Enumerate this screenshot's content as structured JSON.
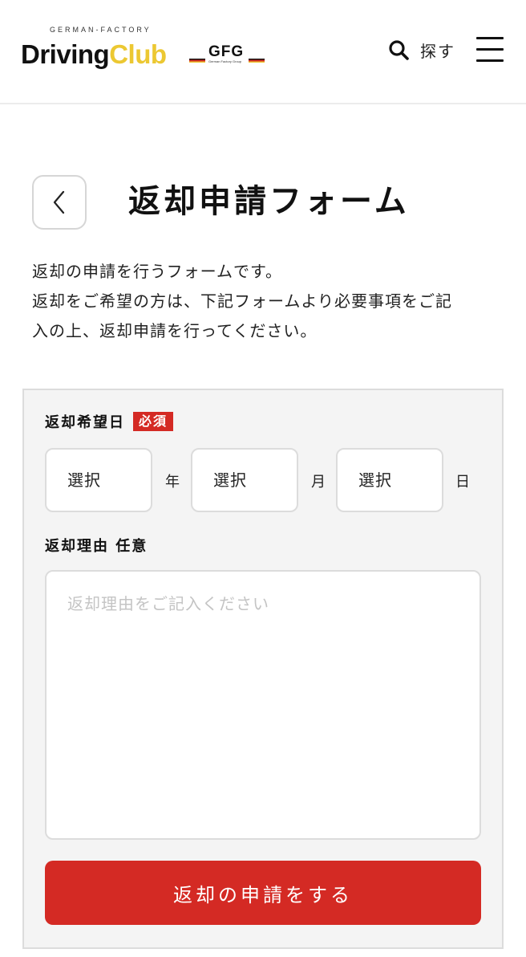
{
  "header": {
    "logo_sub": "GERMAN-FACTORY",
    "logo_driving": "Driving",
    "logo_club": "Club",
    "gfg_text": "GFG",
    "gfg_small": "German Factory Group",
    "search_label": "探す",
    "icons": {
      "search": "search-icon",
      "menu": "hamburger-menu-icon",
      "back": "chevron-left-icon"
    }
  },
  "page": {
    "title": "返却申請フォーム",
    "description_lines": [
      "返却の申請を行うフォームです。",
      "返却をご希望の方は、下記フォームより必要事項をご記",
      "入の上、返却申請を行ってください。"
    ]
  },
  "form": {
    "return_date_label": "返却希望日",
    "required_badge": "必須",
    "year_select": "選択",
    "year_unit": "年",
    "month_select": "選択",
    "month_unit": "月",
    "day_select": "選択",
    "day_unit": "日",
    "reason_label": "返却理由 任意",
    "reason_placeholder": "返却理由をご記入ください",
    "submit_label": "返却の申請をする"
  },
  "colors": {
    "accent_red": "#d42a24",
    "logo_yellow": "#ecc832",
    "form_bg": "#f4f4f4"
  }
}
